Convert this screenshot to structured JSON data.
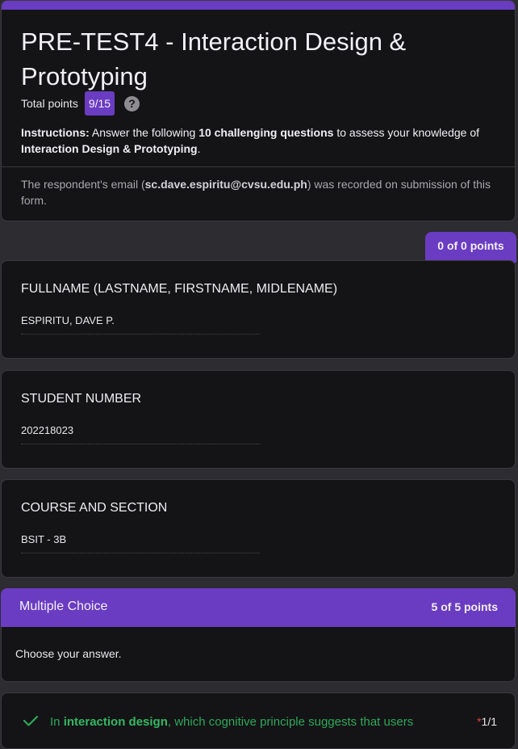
{
  "form": {
    "title": "PRE-TEST4 - Interaction Design & Prototyping",
    "total_points_label": "Total points",
    "total_points_value": "9/15",
    "help_icon_glyph": "?",
    "instructions": {
      "label": "Instructions:",
      "text_1": " Answer the following ",
      "highlight": "10 challenging questions",
      "text_2": " to assess your knowledge of ",
      "subject": "Interaction Design & Prototyping",
      "text_3": "."
    },
    "email_note": {
      "prefix": "The respondent's email (",
      "email": "sc.dave.espiritu@cvsu.edu.ph",
      "suffix": ") was recorded on submission of this form."
    }
  },
  "section1": {
    "points": "0 of 0 points",
    "questions": [
      {
        "title": "FULLNAME (LASTNAME, FIRSTNAME, MIDLENAME)",
        "answer": "ESPIRITU, DAVE P."
      },
      {
        "title": "STUDENT NUMBER",
        "answer": "202218023"
      },
      {
        "title": "COURSE AND SECTION",
        "answer": "BSIT - 3B"
      }
    ]
  },
  "section2": {
    "title": "Multiple Choice",
    "points": "5 of 5 points",
    "description": "Choose your answer.",
    "question1": {
      "text_prefix": "In ",
      "term": "interaction design",
      "text_suffix": ", which cognitive principle suggests that users",
      "required_mark": "*",
      "score": "1/1",
      "status_icon": "check-icon"
    }
  },
  "colors": {
    "accent": "#6a3cc1",
    "correct": "#2fa85a",
    "required": "#e0453a",
    "card_bg": "#141416",
    "page_bg": "#2d2c30"
  }
}
